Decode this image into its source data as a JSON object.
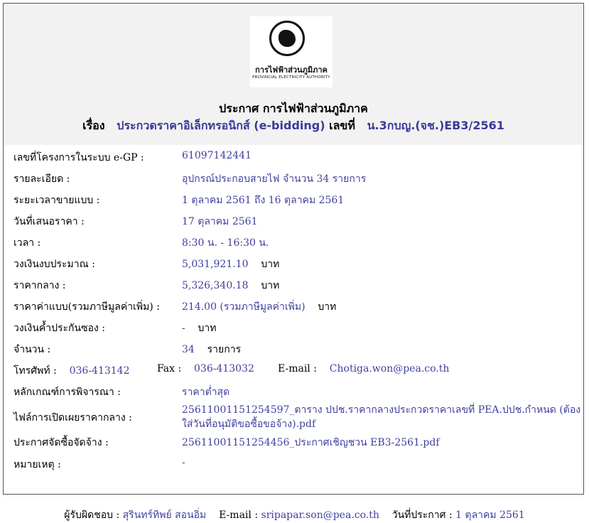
{
  "logo": {
    "name_th": "การไฟฟ้าส่วนภูมิภาค",
    "name_en": "PROVINCIAL ELECTRICITY AUTHORITY",
    "icon": "pea-emblem-icon"
  },
  "announcement": {
    "title": "ประกาศ การไฟฟ้าส่วนภูมิภาค",
    "subject_label": "เรื่อง",
    "subject": "ประกวดราคาอิเล็กทรอนิกส์ (e-bidding)",
    "number_label": "เลขที่",
    "number": "น.3กบญ.(จช.)EB3/2561"
  },
  "details": {
    "project_no_label": "เลขที่โครงการในระบบ e-GP :",
    "project_no": "61097142441",
    "description_label": "รายละเอียด :",
    "description": "อุปกรณ์ประกอบสายไฟ จำนวน 34 รายการ",
    "sale_period_label": "ระยะเวลาขายแบบ :",
    "sale_period": "1 ตุลาคม 2561 ถึง 16 ตุลาคม 2561",
    "bid_date_label": "วันที่เสนอราคา :",
    "bid_date": "17 ตุลาคม 2561",
    "time_label": "เวลา :",
    "time": "8:30 น. - 16:30 น.",
    "budget_label": "วงเงินงบประมาณ :",
    "budget": "5,031,921.10",
    "budget_unit": "บาท",
    "median_price_label": "ราคากลาง :",
    "median_price": "5,326,340.18",
    "median_price_unit": "บาท",
    "doc_fee_label": "ราคาค่าแบบ(รวมภาษีมูลค่าเพิ่ม) :",
    "doc_fee": "214.00 (รวมภาษีมูลค่าเพิ่ม)",
    "doc_fee_unit": "บาท",
    "guarantee_label": "วงเงินค้ำประกันซอง :",
    "guarantee": "-",
    "guarantee_unit": "บาท",
    "quantity_label": "จำนวน :",
    "quantity": "34",
    "quantity_unit": "รายการ",
    "phone_label": "โทรศัพท์ :",
    "phone": "036-413142",
    "fax_label": "Fax :",
    "fax": "036-413032",
    "email_label": "E-mail :",
    "email": "Chotiga.won@pea.co.th",
    "criteria_label": "หลักเกณฑ์การพิจารณา :",
    "criteria": "ราคาต่ำสุด",
    "price_file_label": "ไฟล์การเปิดเผยราคากลาง :",
    "price_file_line1": "25611001151254597_ตาราง ปปช.ราคากลางประกวดราคาเลขที่ PEA.ปปช.กำหนด (ต้อง",
    "price_file_line2": "ใส่วันที่อนุมัติขอซื้อขอจ้าง).pdf",
    "procurement_label": "ประกาศจัดซื้อจัดจ้าง :",
    "procurement_file": "25611001151254456_ประกาศเชิญชวน EB3-2561.pdf",
    "remark_label": "หมายเหตุ :",
    "remark": "-"
  },
  "footer": {
    "responsible_label": "ผู้รับผิดชอบ :",
    "responsible": "สุรินทร์ทิพย์ สอนอิ่ม",
    "email_label": "E-mail :",
    "email": "sripapar.son@pea.co.th",
    "date_label": "วันที่ประกาศ :",
    "date": "1 ตุลาคม 2561"
  }
}
